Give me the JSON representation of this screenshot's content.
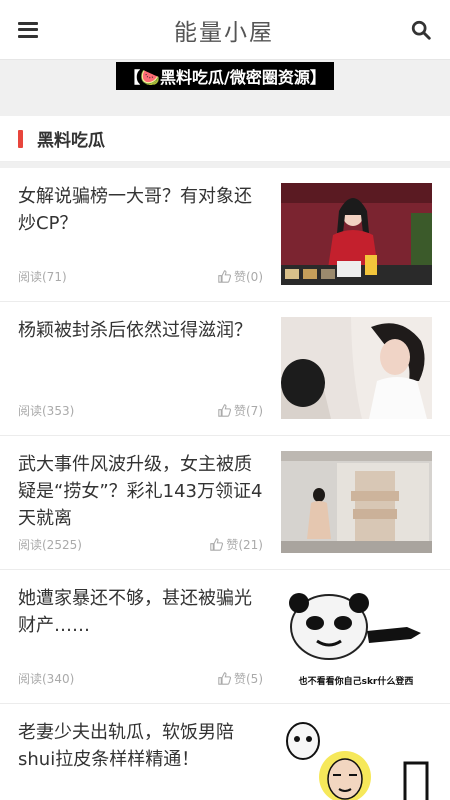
{
  "header": {
    "title": "能量小屋",
    "menu_icon": "hamburger-menu-icon",
    "search_icon": "search-icon"
  },
  "banner": {
    "text": "【🍉黑料吃瓜/微密圈资源】"
  },
  "section": {
    "title": "黑料吃瓜",
    "accent_color": "#e8453c"
  },
  "articles": [
    {
      "title": "女解说骗榜一大哥？有对象还炒CP？",
      "reads": "阅读(71)",
      "likes": "赞(0)"
    },
    {
      "title": "杨颖被封杀后依然过得滋润？",
      "reads": "阅读(353)",
      "likes": "赞(7)"
    },
    {
      "title": "武大事件风波升级，女主被质疑是“捞女”？彩礼143万领证4天就离",
      "reads": "阅读(2525)",
      "likes": "赞(21)"
    },
    {
      "title": "她遭家暴还不够，甚还被骗光财产……",
      "reads": "阅读(340)",
      "likes": "赞(5)",
      "thumb_caption": "也不看看你自己skr什么登西"
    },
    {
      "title": "老妻少夫出轨瓜，软饭男陪shui拉皮条样样精通！",
      "reads": "",
      "likes": ""
    }
  ]
}
